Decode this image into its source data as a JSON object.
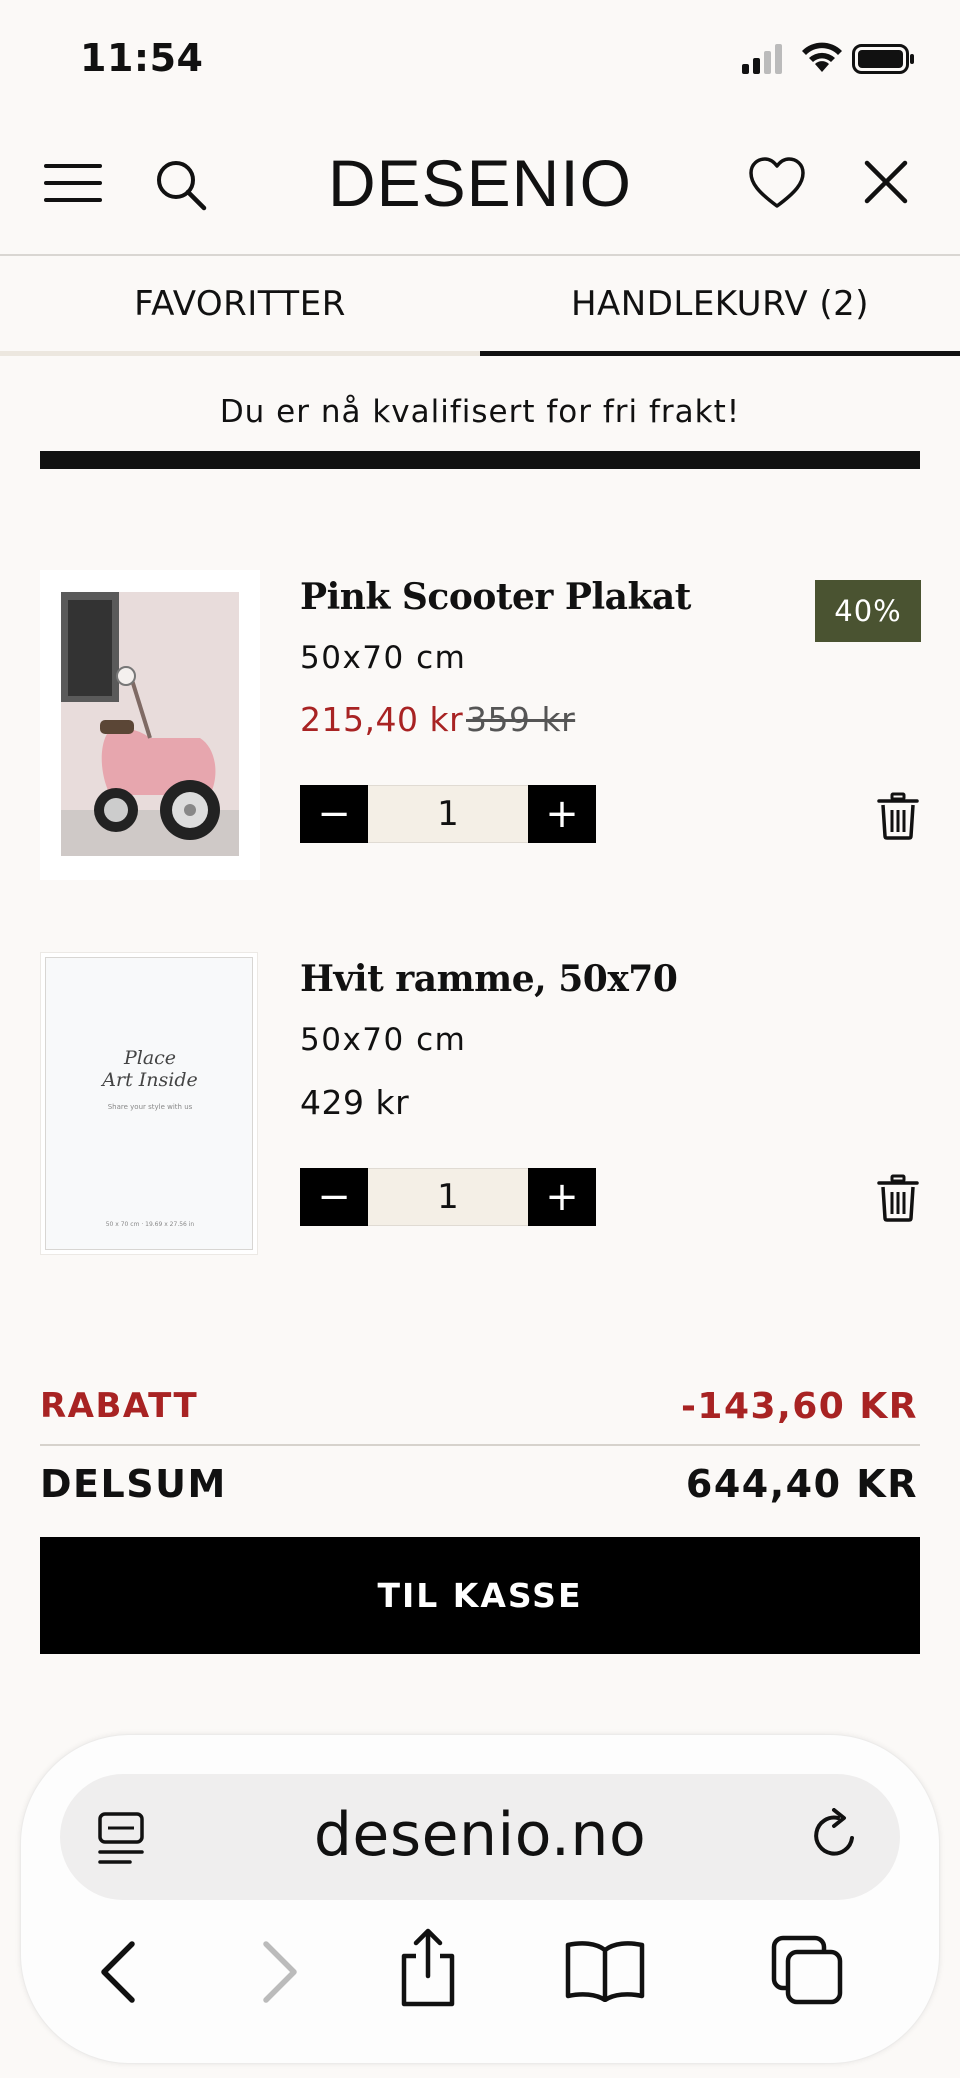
{
  "status_bar": {
    "time": "11:54"
  },
  "header": {
    "logo": "DESENIO"
  },
  "tabs": {
    "favorites": "FAVORITTER",
    "cart": "HANDLEKURV (2)"
  },
  "shipping": {
    "message": "Du er nå kvalifisert for fri frakt!",
    "progress": 1.0
  },
  "items": [
    {
      "title": "Pink Scooter Plakat",
      "size": "50x70 cm",
      "price": "215,40 kr",
      "original_price": "359 kr",
      "badge": "40%",
      "quantity": "1",
      "minus": "−",
      "plus": "+"
    },
    {
      "title": "Hvit ramme, 50x70",
      "size": "50x70 cm",
      "price": "429 kr",
      "quantity": "1",
      "minus": "−",
      "plus": "+",
      "thumb_text": "Place",
      "thumb_text2": "Art Inside",
      "thumb_sub": "Share your style with us",
      "thumb_foot": "50 x 70 cm · 19.69 x 27.56 in"
    }
  ],
  "totals": {
    "discount_label": "RABATT",
    "discount_value": "-143,60 KR",
    "subtotal_label": "DELSUM",
    "subtotal_value": "644,40 KR"
  },
  "checkout": {
    "label": "TIL KASSE"
  },
  "browser": {
    "url": "desenio.no"
  },
  "colors": {
    "sale_red": "#a82323",
    "badge_green": "#4a5331",
    "background": "#fbf9f7"
  }
}
